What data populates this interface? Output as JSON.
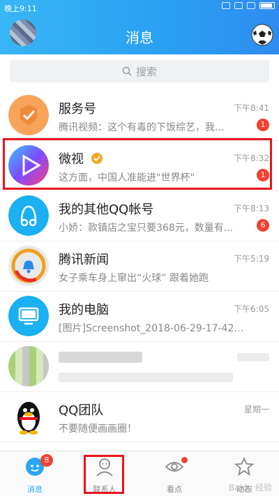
{
  "status_bar": {
    "time": "晚上9:11"
  },
  "header": {
    "title": "消息"
  },
  "search": {
    "placeholder": "搜索"
  },
  "conversations": [
    {
      "name": "服务号",
      "time": "下午8:41",
      "message": "腾讯视频：这个有毒的下饭综艺，我...",
      "badge": "1",
      "icon": "service-icon"
    },
    {
      "name": "微视",
      "time": "下午8:32",
      "message": "这方面，中国人准能进\"世界杯\"",
      "badge": "1",
      "icon": "weishi-icon"
    },
    {
      "name": "我的其他QQ帐号",
      "time": "下午8:13",
      "message": "小娇：款镇店之宝只要368元，数量有...",
      "badge": "6",
      "icon": "qq-account-icon"
    },
    {
      "name": "腾讯新闻",
      "time": "下午5:19",
      "message": "女子乘车身上窜出“火球” 跟着她跑",
      "icon": "news-icon"
    },
    {
      "name": "我的电脑",
      "time": "下午6:05",
      "message": "[图片]Screenshot_2018-06-29-17-42-26-...",
      "icon": "computer-icon"
    },
    {
      "name": "QQ团队",
      "time": "星期一",
      "message": "不要随便画画圈！",
      "icon": "qq-penguin-icon"
    }
  ],
  "bottom_nav": {
    "messages": {
      "label": "消息",
      "badge": "8"
    },
    "contacts": {
      "label": "联系人"
    },
    "watch": {
      "label": "看点"
    },
    "feed": {
      "label": "动态"
    }
  },
  "watermark": "Baidu 经验",
  "colors": {
    "header": "#2a9ff2",
    "badge": "#f3402f",
    "highlight": "#e8141d"
  }
}
